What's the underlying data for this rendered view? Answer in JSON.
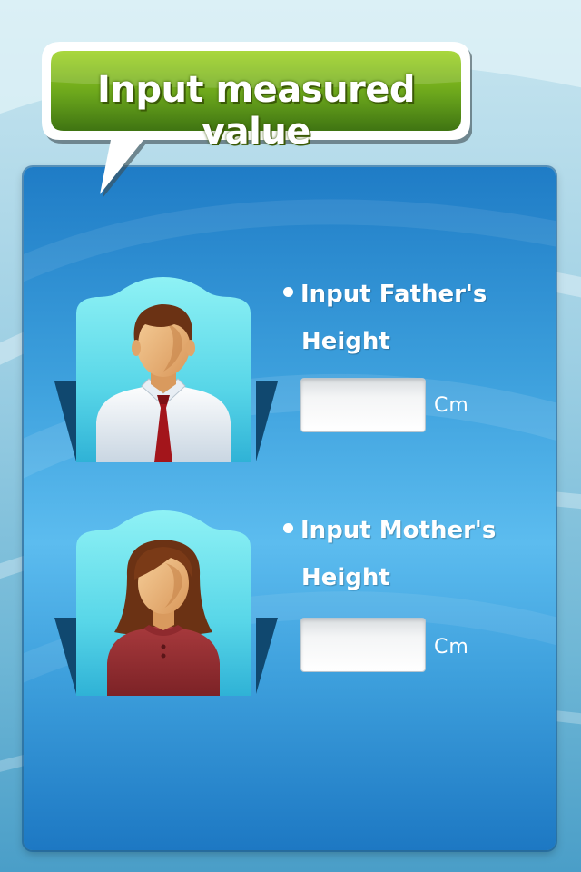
{
  "header": {
    "title": "Input measured value"
  },
  "father": {
    "label_line1": "Input Father's",
    "label_line2": "Height",
    "input_value": "",
    "unit": "Cm",
    "avatar_icon": "male-avatar-icon"
  },
  "mother": {
    "label_line1": "Input Mother's",
    "label_line2": "Height",
    "input_value": "",
    "unit": "Cm",
    "avatar_icon": "female-avatar-icon"
  },
  "colors": {
    "bubble_green": "#6aa51c",
    "panel_blue": "#3c9fdc",
    "card_cyan": "#7be6ee",
    "text": "#ffffff"
  }
}
